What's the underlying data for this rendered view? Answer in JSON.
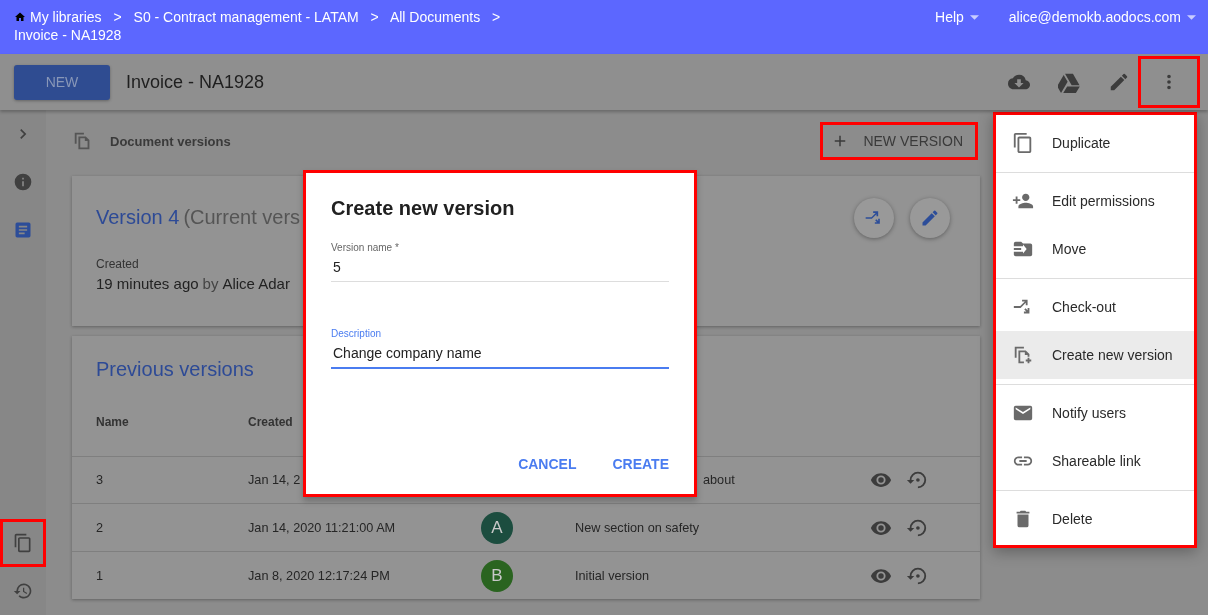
{
  "top_bar": {
    "breadcrumb": [
      {
        "label": "My libraries"
      },
      {
        "label": "S0 - Contract management - LATAM"
      },
      {
        "label": "All Documents"
      }
    ],
    "separator": ">",
    "current": "Invoice - NA1928",
    "help": "Help",
    "account": "alice@demokb.aodocs.com"
  },
  "toolbar": {
    "new_button": "NEW",
    "title": "Invoice - NA1928",
    "actions": [
      {
        "annotated": false
      },
      {
        "annotated": false
      },
      {
        "annotated": false
      },
      {
        "annotated": true
      }
    ]
  },
  "rail": {
    "top": [
      {
        "selected": false,
        "annotated": false
      },
      {
        "selected": false,
        "annotated": false
      },
      {
        "selected": true,
        "annotated": false
      }
    ],
    "bottom": [
      {
        "selected": false,
        "annotated": true
      },
      {
        "selected": false,
        "annotated": false
      }
    ]
  },
  "section": {
    "title": "Document versions",
    "new_version_button": {
      "label": "NEW VERSION",
      "annotated": true
    }
  },
  "current_version": {
    "name": "Version 4",
    "note": "(Current vers",
    "created_label": "Created",
    "when": "19 minutes ago",
    "by": "by",
    "author": "Alice Adar"
  },
  "previous_versions": {
    "title": "Previous versions",
    "columns": [
      "Name",
      "Created"
    ],
    "rows": [
      {
        "name": "3",
        "created": "Jan 14, 2",
        "avatar": null,
        "description": "about",
        "covered": true
      },
      {
        "name": "2",
        "created": "Jan 14, 2020 11:21:00 AM",
        "avatar": {
          "letter": "A",
          "color": "#1c4d3f"
        },
        "description": "New section on safety",
        "covered": false
      },
      {
        "name": "1",
        "created": "Jan 8, 2020 12:17:24 PM",
        "avatar": {
          "letter": "B",
          "color": "#2a6420"
        },
        "description": "Initial version",
        "covered": false
      }
    ]
  },
  "dialog": {
    "title": "Create new version",
    "annotated": true,
    "fields": [
      {
        "label": "Version name *",
        "value": "5",
        "focused": false
      },
      {
        "label": "Description",
        "value": "Change company name",
        "focused": true
      }
    ],
    "buttons": [
      "CANCEL",
      "CREATE"
    ]
  },
  "menu": {
    "annotated": true,
    "groups": [
      {
        "items": [
          {
            "label": "Duplicate",
            "selected": false
          }
        ]
      },
      {
        "items": [
          {
            "label": "Edit permissions",
            "selected": false
          },
          {
            "label": "Move",
            "selected": false
          }
        ]
      },
      {
        "items": [
          {
            "label": "Check-out",
            "selected": false
          },
          {
            "label": "Create new version",
            "selected": true
          }
        ]
      },
      {
        "items": [
          {
            "label": "Notify users",
            "selected": false
          },
          {
            "label": "Shareable link",
            "selected": false
          }
        ]
      },
      {
        "items": [
          {
            "label": "Delete",
            "selected": false
          }
        ]
      }
    ]
  }
}
